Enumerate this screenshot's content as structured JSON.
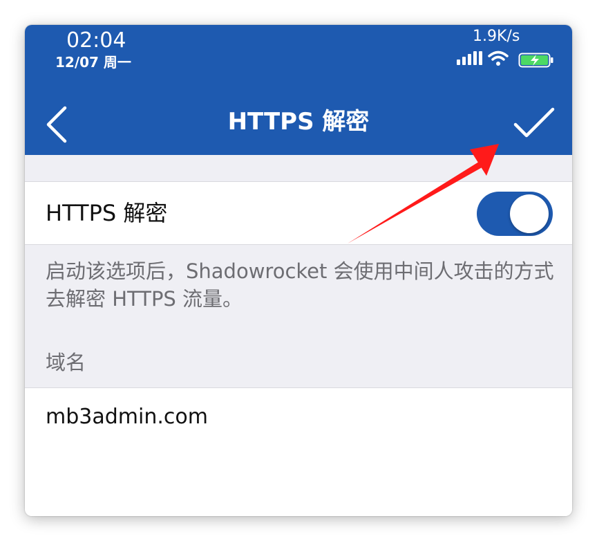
{
  "status_bar": {
    "time": "02:04",
    "date": "12/07 周一",
    "net_speed": "1.9K/s",
    "icons": [
      "signal-icon",
      "wifi-icon",
      "battery-charging-icon"
    ],
    "battery_color": "#4cd964"
  },
  "nav": {
    "title": "HTTPS 解密",
    "back_icon": "chevron-left-icon",
    "done_icon": "checkmark-icon"
  },
  "settings": {
    "toggle_label": "HTTPS 解密",
    "toggle_on": true,
    "description": "启动该选项后，Shadowrocket 会使用中间人攻击的方式去解密 HTTPS 流量。",
    "domain_section_header": "域名",
    "domain_value": "mb3admin.com"
  },
  "annotation": {
    "arrow_color": "#ff1a1a",
    "points_to": "checkmark-icon"
  },
  "colors": {
    "accent": "#1e5ab0",
    "grouped_background": "#efeff4",
    "secondary_text": "#6d6d72"
  }
}
